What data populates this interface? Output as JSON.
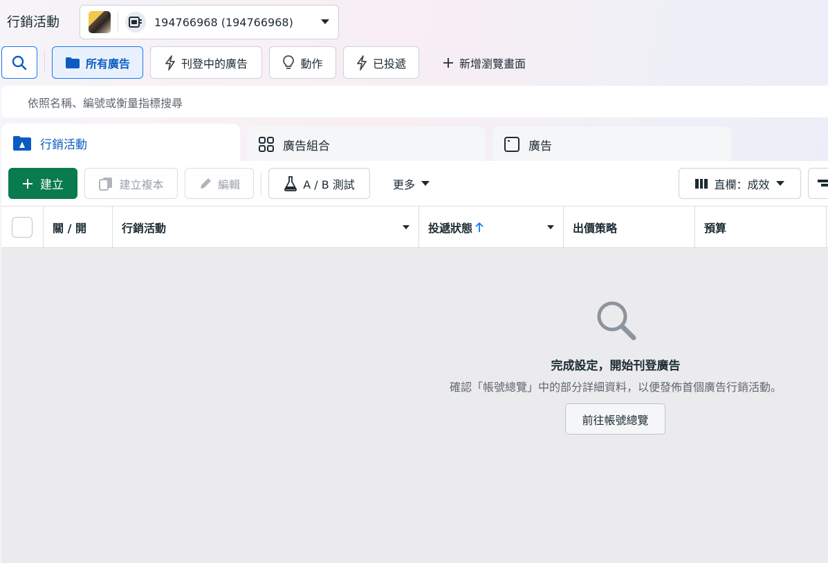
{
  "page_title": "行銷活動",
  "account": {
    "id_text": "194766968 (194766968)"
  },
  "toolbar": {
    "all_ads": "所有廣告",
    "active_ads": "刊登中的廣告",
    "actions": "動作",
    "delivered": "已投遞",
    "new_view": "新增瀏覽畫面"
  },
  "search": {
    "placeholder": "依照名稱、編號或衡量指標搜尋"
  },
  "tabs": [
    {
      "label": "行銷活動"
    },
    {
      "label": "廣告組合"
    },
    {
      "label": "廣告"
    }
  ],
  "actions": {
    "create": "建立",
    "duplicate": "建立複本",
    "edit": "編輯",
    "ab_test": "A / B 測試",
    "more": "更多",
    "columns": "直欄：成效"
  },
  "table": {
    "columns": [
      "關 / 開",
      "行銷活動",
      "投遞狀態",
      "出價策略",
      "預算"
    ]
  },
  "empty_state": {
    "title": "完成設定，開始刊登廣告",
    "description": "確認「帳號總覽」中的部分詳細資料，以便發佈首個廣告行銷活動。",
    "button": "前往帳號總覽"
  },
  "colors": {
    "accent": "#1877f2",
    "create_green": "#0a7a4f",
    "empty_bg": "#ebebed"
  },
  "icons": {
    "search": "search-icon",
    "folder": "folder-icon",
    "bolt": "bolt-icon",
    "bulb": "lightbulb-icon",
    "plus": "plus-icon",
    "copy": "copy-icon",
    "pencil": "pencil-icon",
    "flask": "flask-icon",
    "columns": "columns-icon",
    "sort": "sort-arrow-up-icon"
  }
}
